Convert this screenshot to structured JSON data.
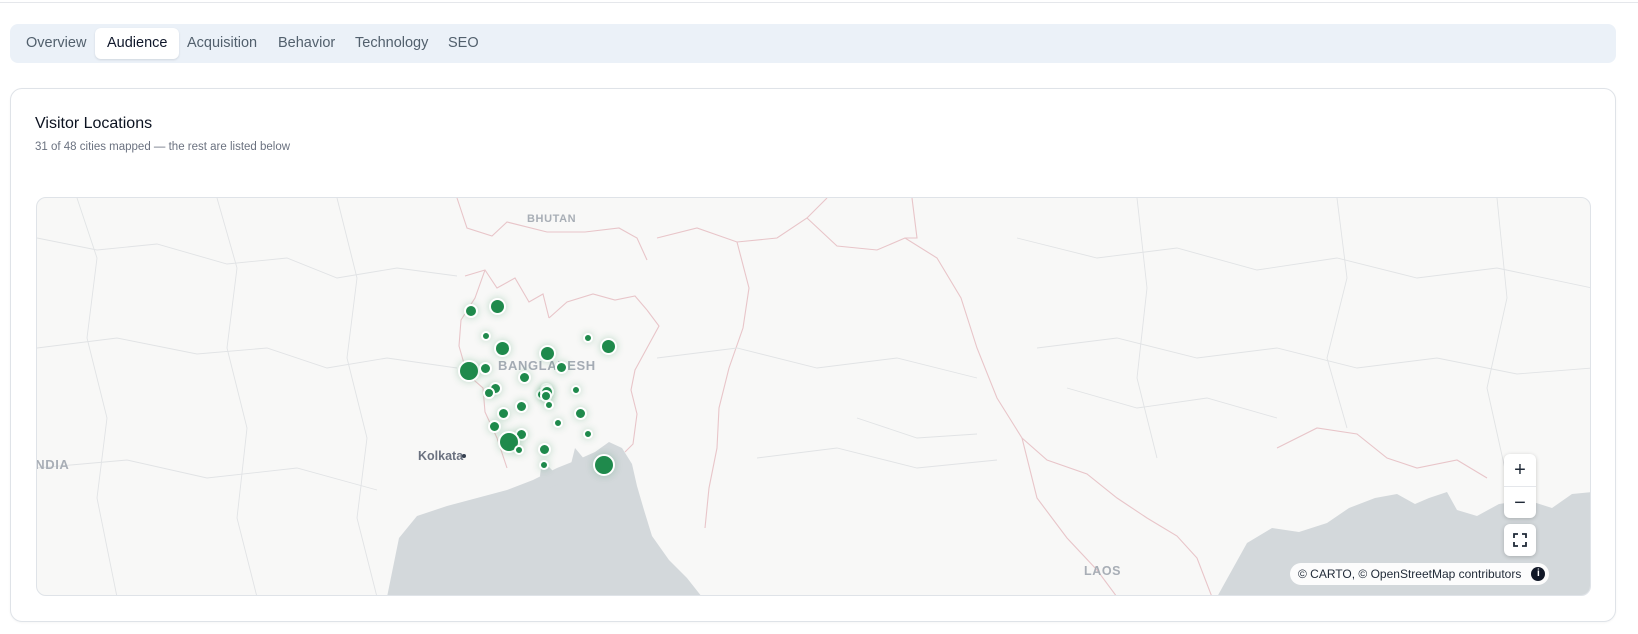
{
  "tabs": [
    {
      "label": "Overview"
    },
    {
      "label": "Audience"
    },
    {
      "label": "Acquisition"
    },
    {
      "label": "Behavior"
    },
    {
      "label": "Technology"
    },
    {
      "label": "SEO"
    }
  ],
  "active_tab": "Audience",
  "card": {
    "title": "Visitor Locations",
    "subtitle": "31 of 48 cities mapped — the rest are listed below"
  },
  "map": {
    "place_labels": {
      "bhutan": "BHUTAN",
      "bangladesh": "BANGLADESH",
      "india": "INDIA",
      "laos": "LAOS",
      "kolkata": "Kolkata"
    },
    "controls": {
      "zoom_in": "+",
      "zoom_out": "−",
      "info": "i"
    },
    "attribution": "© CARTO, © OpenStreetMap contributors",
    "marker_color": "#1f8a4c",
    "water_color": "#d3d8db",
    "land_color": "#f8f8f7",
    "border_color": "#e8c5c9"
  }
}
